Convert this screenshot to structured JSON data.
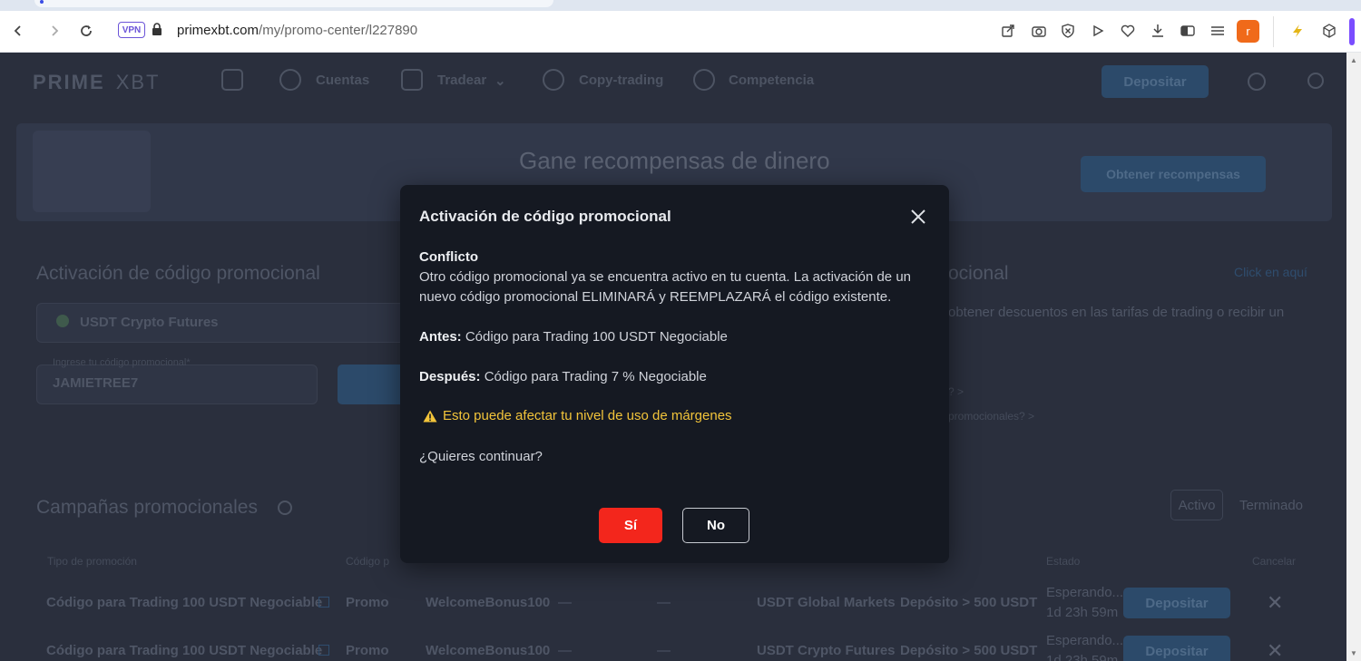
{
  "browser": {
    "vpn_label": "VPN",
    "url_host": "primexbt.com",
    "url_path": "/my/promo-center/l227890",
    "profile_initial": "r"
  },
  "nav": {
    "logo_prime": "PRIME",
    "logo_xbt": "XBT",
    "items": [
      "Cuentas",
      "Tradear",
      "Copy-trading",
      "Competencia"
    ],
    "deposit_label": "Depositar"
  },
  "banner": {
    "title": "Gane recompensas de dinero",
    "cta": "Obtener recompensas"
  },
  "activation": {
    "title": "Activación de código promocional",
    "market": "USDT Crypto Futures",
    "code_label": "Ingrese tu código promocional*",
    "code_value": "JAMIETREE7"
  },
  "right_panel": {
    "title_fragment": "ocional",
    "link": "Click en aquí",
    "text1": "obtener descuentos en las tarifas de trading o recibir un",
    "text2": "promocionales? >",
    "text3": "? >"
  },
  "campaigns": {
    "title": "Campañas promocionales",
    "tab_active": "Activo",
    "tab_done": "Terminado",
    "headers": [
      "Tipo de promoción",
      "Código p",
      "Estado",
      "Cancelar"
    ],
    "rows": [
      {
        "name": "Código para Trading 100 USDT Negociable",
        "type": "Promo",
        "code": "WelcomeBonus100",
        "dash1": "—",
        "dash2": "—",
        "market": "USDT Global Markets",
        "condition": "Depósito > 500 USDT",
        "status1": "Esperando...",
        "status2": "1d 23h 59m",
        "action": "Depositar"
      },
      {
        "name": "Código para Trading 100 USDT Negociable",
        "type": "Promo",
        "code": "WelcomeBonus100",
        "dash1": "—",
        "dash2": "—",
        "market": "USDT Crypto Futures",
        "condition": "Depósito > 500 USDT",
        "status1": "Esperando...",
        "status2": "1d 23h 59m",
        "action": "Depositar"
      }
    ]
  },
  "modal": {
    "title": "Activación de código promocional",
    "conflict_heading": "Conflicto",
    "conflict_line1": "Otro código promocional ya se encuentra activo en tu cuenta. La activación de un",
    "conflict_line2": "nuevo código promocional ELIMINARÁ y REEMPLAZARÁ el código existente.",
    "before_label": "Antes:",
    "before_value": " Código para Trading 100 USDT Negociable",
    "after_label": "Después:",
    "after_value": " Código para Trading 7 % Negociable",
    "warning": "Esto puede afectar tu nivel de uso de márgenes",
    "question": "¿Quieres continuar?",
    "yes_label": "Sí",
    "no_label": "No",
    "warning_color": "#f2c43a",
    "yes_color": "#f3261c"
  }
}
